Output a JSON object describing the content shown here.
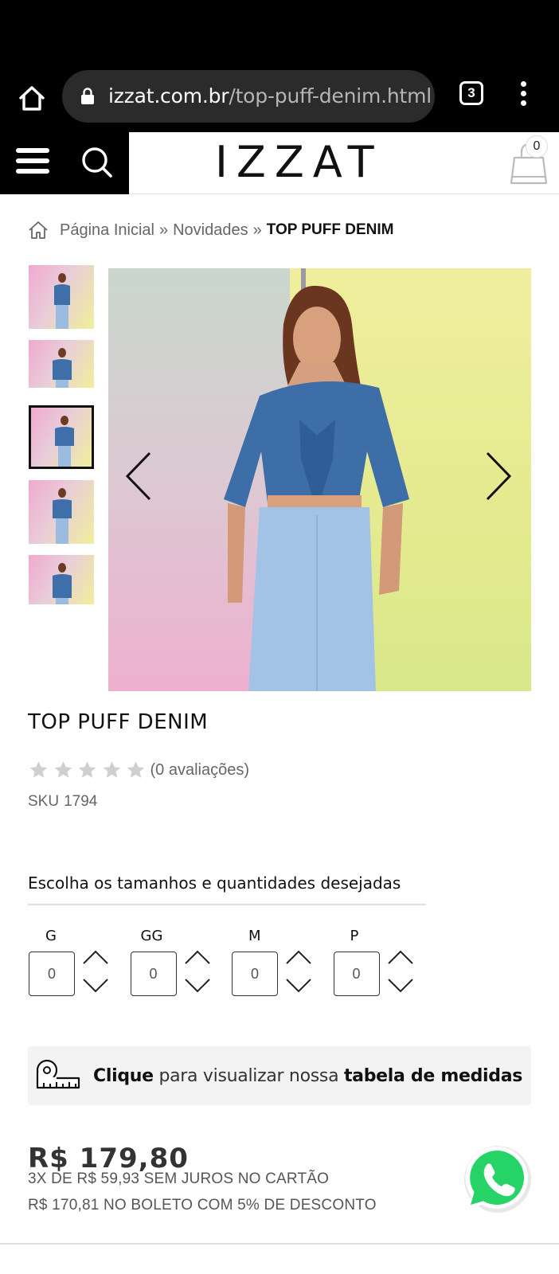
{
  "browser": {
    "url_domain": "izzat.com.br",
    "url_path": "/top-puff-denim.html",
    "tab_count": "3"
  },
  "header": {
    "logo": "IZZAT",
    "cart_count": "0"
  },
  "breadcrumb": {
    "items": [
      "Página Inicial",
      "Novidades"
    ],
    "separator": "»",
    "current": "TOP PUFF DENIM"
  },
  "gallery": {
    "thumbnail_count": 5,
    "active_index": 2
  },
  "product": {
    "title": "TOP PUFF DENIM",
    "rating_stars": 5,
    "rating_value": 0,
    "rating_text": "(0 avaliações)",
    "sku_label": "SKU",
    "sku_value": "1794"
  },
  "sizes": {
    "heading": "Escolha os tamanhos e quantidades desejadas",
    "items": [
      {
        "label": "G",
        "value": "0"
      },
      {
        "label": "GG",
        "value": "0"
      },
      {
        "label": "M",
        "value": "0"
      },
      {
        "label": "P",
        "value": "0"
      }
    ]
  },
  "measure": {
    "bold1": "Clique",
    "middle": " para visualizar nossa ",
    "bold2": "tabela de medidas"
  },
  "pricing": {
    "price": "R$ 179,80",
    "installments": "3X DE R$ 59,93 SEM JUROS NO CARTÃO",
    "boleto": "R$ 170,81 NO BOLETO COM 5% DE DESCONTO"
  },
  "icons": {
    "home": "home-icon",
    "lock": "lock-icon",
    "menu": "menu-icon",
    "search": "search-icon",
    "bag": "shopping-bag-icon",
    "star": "star-icon",
    "tape": "measuring-tape-icon",
    "whatsapp": "whatsapp-icon"
  },
  "colors": {
    "star": "#cfcfcf",
    "whatsapp": "#25d366",
    "header_dark": "#000000"
  }
}
